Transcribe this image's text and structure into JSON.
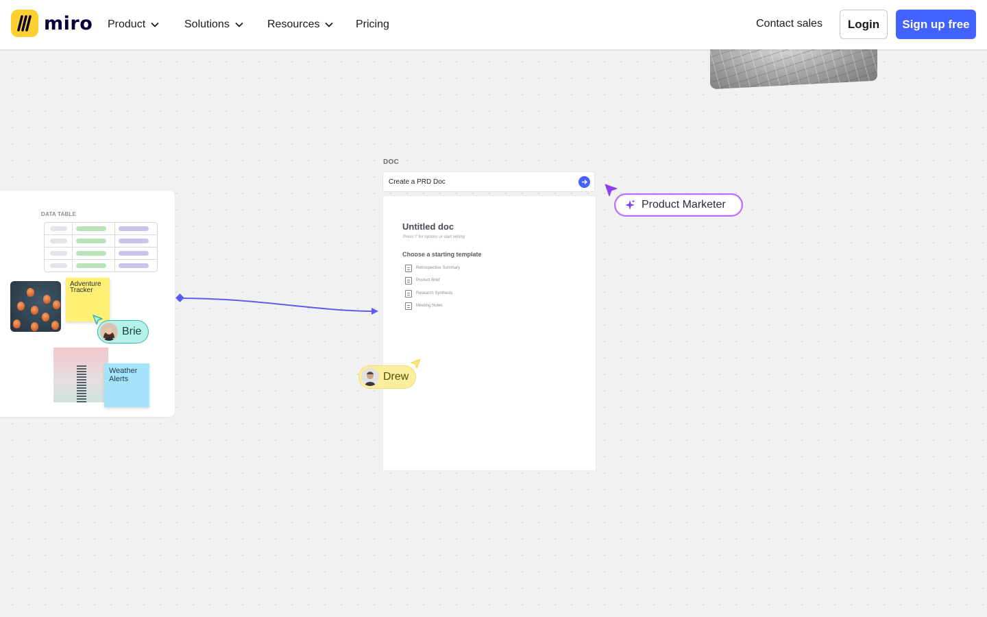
{
  "header": {
    "logo_text": "miro",
    "nav": [
      {
        "label": "Product"
      },
      {
        "label": "Solutions"
      },
      {
        "label": "Resources"
      },
      {
        "label": "Pricing"
      }
    ],
    "contact_label": "Contact sales",
    "login_label": "Login",
    "signup_label": "Sign up free"
  },
  "board": {
    "data_table_label": "DATA TABLE",
    "sticky_yellow": "Adventure Tracker",
    "sticky_blue": "Weather Alerts"
  },
  "doc": {
    "label": "DOC",
    "prompt": "Create a PRD Doc",
    "title": "Untitled doc",
    "subtitle": "Press '/' for options or start writing",
    "choose": "Choose a starting template",
    "templates": [
      "Retrospective Summary",
      "Product Brief",
      "Research Synthesis",
      "Meeting Notes"
    ]
  },
  "cursors": {
    "brie": "Brie",
    "drew": "Drew",
    "ai": "Product Marketer"
  },
  "colors": {
    "brand_yellow": "#ffd02f",
    "accent_blue": "#4262ff",
    "connector": "#5b5bf0",
    "ai_purple": "#b36dff"
  },
  "icons": [
    "chevron-down-icon",
    "arrow-right-icon",
    "sparkle-icon",
    "document-icon",
    "cursor-icon"
  ]
}
